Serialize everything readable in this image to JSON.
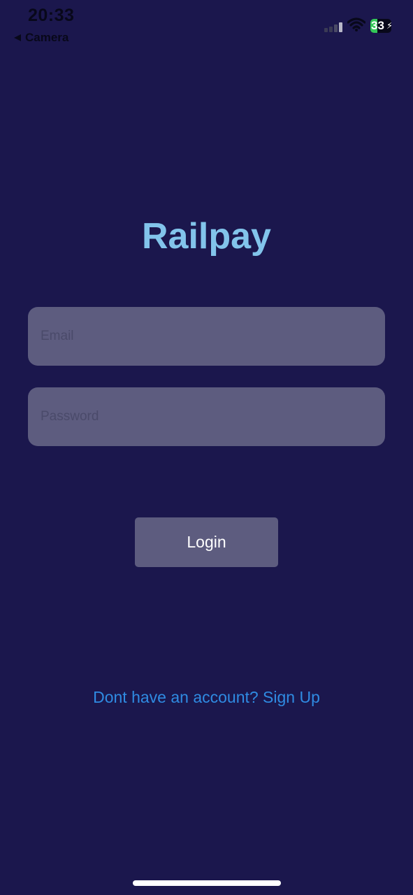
{
  "status_bar": {
    "time": "20:33",
    "back_label": "Camera",
    "battery_level": "33",
    "battery_fraction": 0.33,
    "icons": [
      "signal-icon",
      "wifi-icon",
      "battery-icon"
    ]
  },
  "app": {
    "title": "Railpay"
  },
  "form": {
    "email_placeholder": "Email",
    "email_value": "",
    "password_placeholder": "Password",
    "password_value": "",
    "login_label": "Login"
  },
  "footer": {
    "signup_text": "Dont have an account? Sign Up"
  },
  "colors": {
    "background": "#1b174d",
    "title": "#82c4eb",
    "field": "#5d5c7f",
    "link": "#2f8be2"
  }
}
